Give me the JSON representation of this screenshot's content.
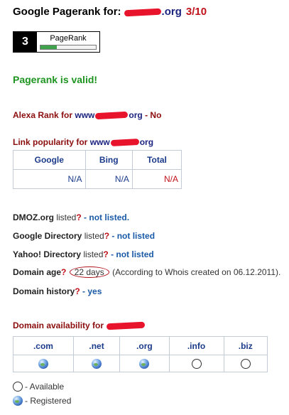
{
  "header": {
    "title_prefix": "Google Pagerank for:",
    "domain_suffix": ".org",
    "score": "3/10"
  },
  "pagerank_badge": {
    "value": "3",
    "label": "PageRank",
    "fill_fraction": 0.3
  },
  "valid_text": "Pagerank is valid!",
  "alexa": {
    "prefix": "Alexa Rank for",
    "domain_start": "www",
    "domain_end": "org",
    "result": "- No"
  },
  "link_popularity": {
    "prefix": "Link popularity for",
    "domain_start": "www",
    "domain_end": "org",
    "columns": [
      "Google",
      "Bing",
      "Total"
    ],
    "values": [
      "N/A",
      "N/A",
      "N/A"
    ]
  },
  "listings": [
    {
      "label": "DMOZ.org",
      "suffix": " listed",
      "q": "?",
      "result": " - not listed."
    },
    {
      "label": "Google Directory",
      "suffix": " listed",
      "q": "?",
      "result": " - not listed"
    },
    {
      "label": "Yahoo! Directory",
      "suffix": " listed",
      "q": "?",
      "result": " - not listed"
    }
  ],
  "domain_age": {
    "label": "Domain age",
    "q": "?",
    "days": "22 days",
    "note": "(According to Whois created on 06.12.2011)."
  },
  "domain_history": {
    "label": "Domain history",
    "q": "?",
    "result": " - yes"
  },
  "availability": {
    "prefix": "Domain availability for",
    "columns": [
      ".com",
      ".net",
      ".org",
      ".info",
      ".biz"
    ],
    "status": [
      "registered",
      "registered",
      "registered",
      "available",
      "available"
    ]
  },
  "legend": {
    "available": "- Available",
    "registered": "- Registered"
  }
}
